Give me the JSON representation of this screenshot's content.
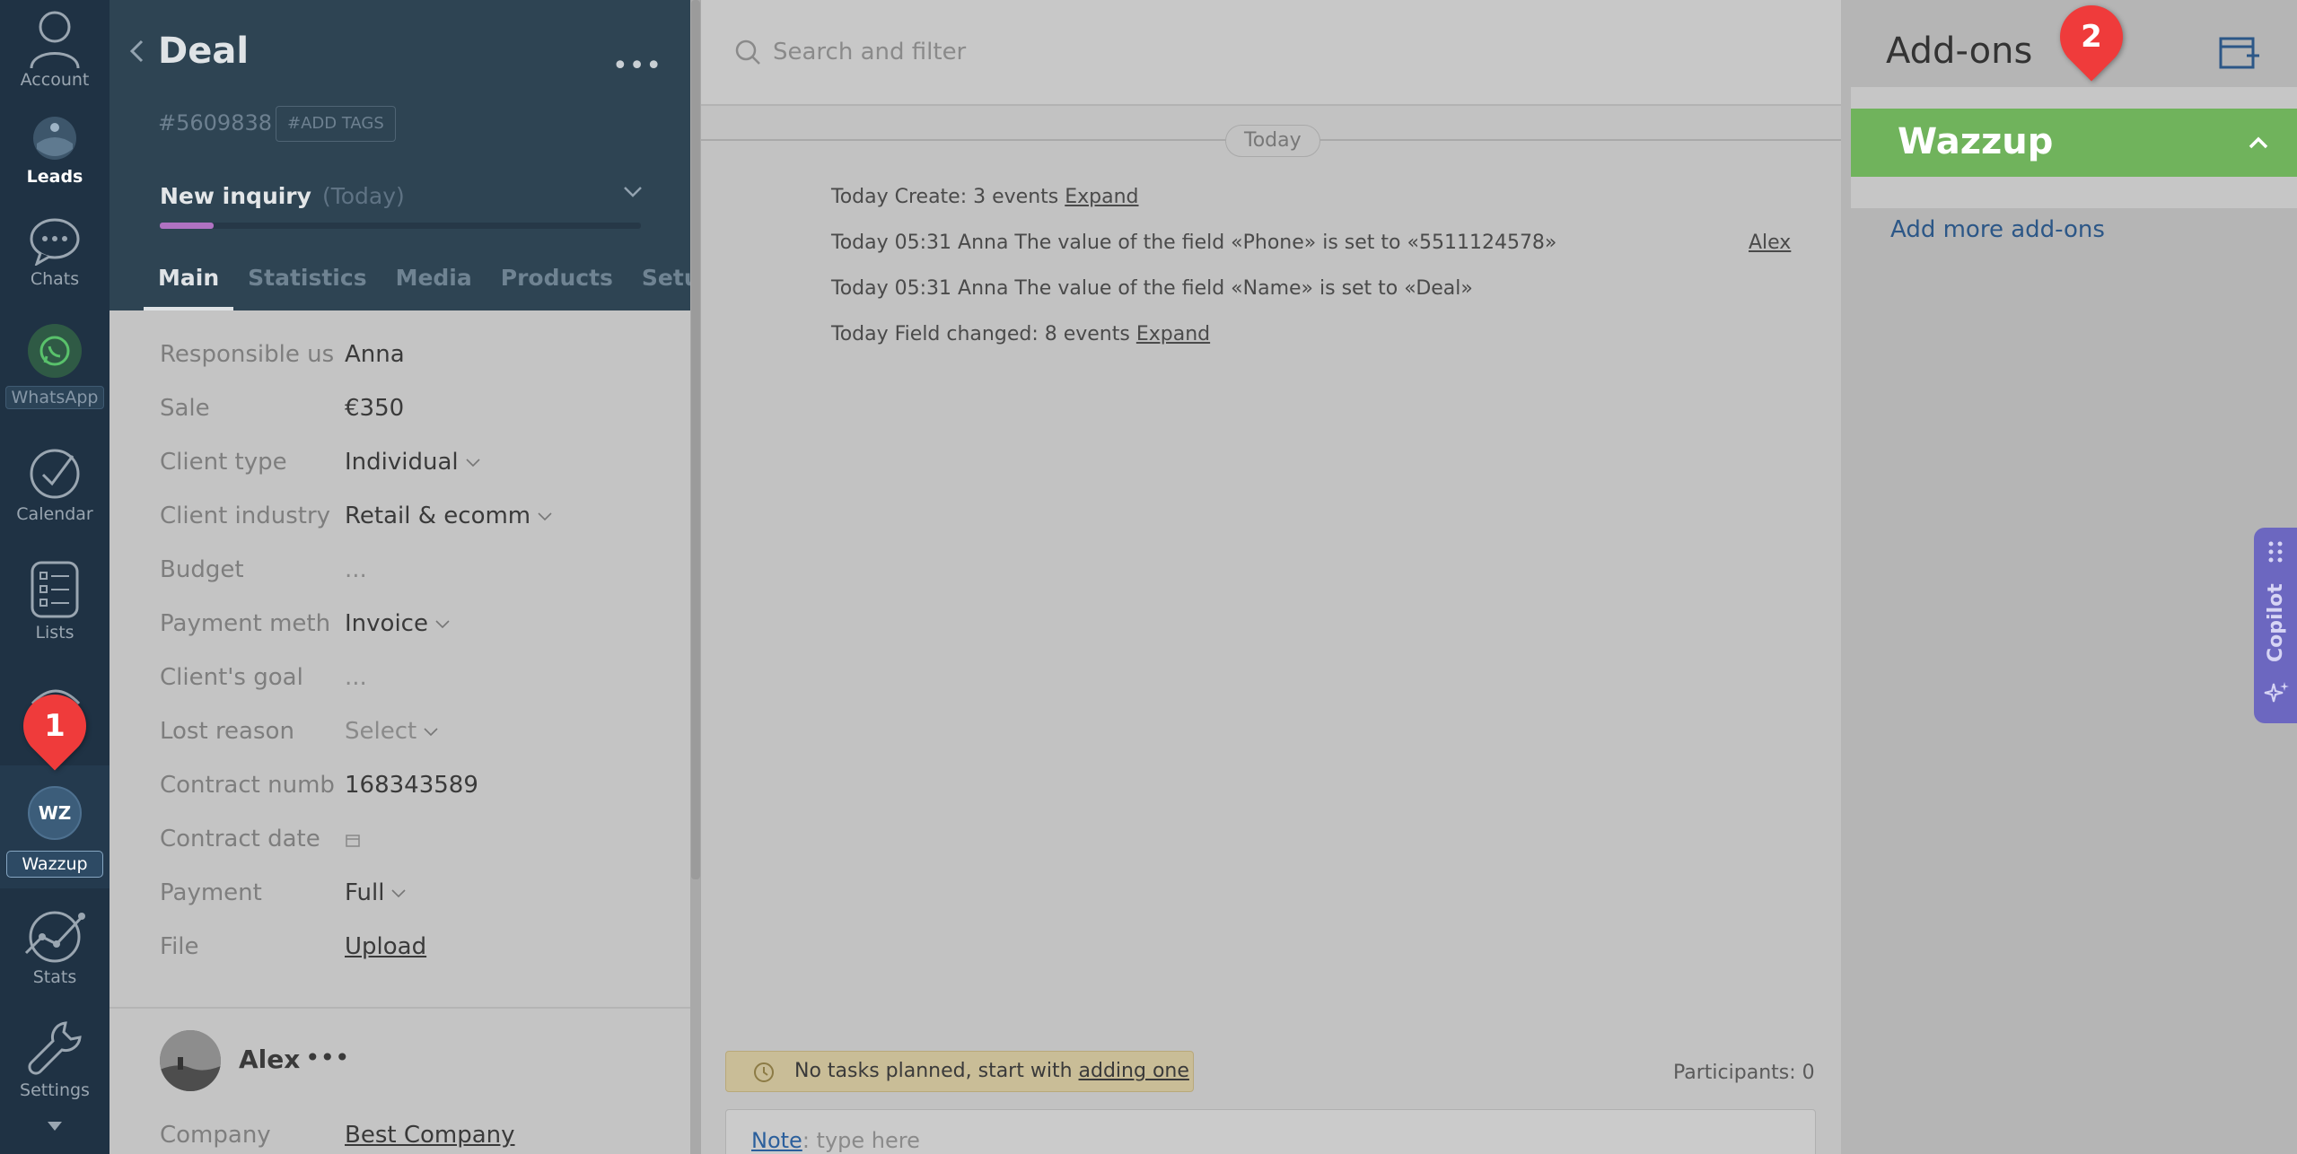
{
  "nav": {
    "account": "Account",
    "leads": "Leads",
    "chats": "Chats",
    "whatsapp": "WhatsApp",
    "calendar": "Calendar",
    "lists": "Lists",
    "wazzup_avatar": "WZ",
    "wazzup": "Wazzup",
    "stats": "Stats",
    "settings": "Settings"
  },
  "markers": {
    "one": "1",
    "two": "2"
  },
  "deal": {
    "title": "Deal",
    "id": "#5609838",
    "add_tags": "#ADD TAGS",
    "stage": "New inquiry",
    "stage_date": "(Today)",
    "tabs": [
      "Main",
      "Statistics",
      "Media",
      "Products",
      "Setup"
    ],
    "fields": [
      {
        "label": "Responsible us",
        "value": "Anna"
      },
      {
        "label": "Sale",
        "value": "€350"
      },
      {
        "label": "Client type",
        "value": "Individual"
      },
      {
        "label": "Client industry",
        "value": "Retail & ecomm"
      },
      {
        "label": "Budget",
        "value": "..."
      },
      {
        "label": "Payment meth",
        "value": "Invoice"
      },
      {
        "label": "Client's goal",
        "value": "..."
      },
      {
        "label": "Lost reason",
        "value": "Select"
      },
      {
        "label": "Contract numb",
        "value": "168343589"
      },
      {
        "label": "Contract date",
        "value": ""
      },
      {
        "label": "Payment",
        "value": "Full"
      },
      {
        "label": "File",
        "value": "Upload"
      }
    ],
    "contact_name": "Alex",
    "company_label": "Company",
    "company_value": "Best Company"
  },
  "feed": {
    "search_placeholder": "Search and filter",
    "today_pill": "Today",
    "events": [
      {
        "text": "Today Create: 3 events ",
        "link": "Expand"
      },
      {
        "text": "Today 05:31 Anna The value of the field «Phone» is set to «5511124578»",
        "link": ""
      },
      {
        "text": "Today 05:31 Anna The value of the field «Name» is set to «Deal»",
        "link": ""
      },
      {
        "text": "Today Field changed: 8 events ",
        "link": "Expand"
      }
    ],
    "event_author": "Alex",
    "tasks_text": "No tasks planned, start with ",
    "tasks_link": "adding one",
    "participants": "Participants: 0",
    "note_label": "Note",
    "note_placeholder": ": type here"
  },
  "addons": {
    "title": "Add-ons",
    "widget_name": "Wazzup",
    "add_more": "Add more add-ons",
    "copilot": "Copilot"
  },
  "colors": {
    "nav_bg": "#1f3244",
    "card_header": "#2e4453",
    "wazzup_green": "#70b35c",
    "marker_red": "#ef3b3b",
    "copilot_purple": "#6c67c0",
    "stage_progress": "#b072c2"
  }
}
